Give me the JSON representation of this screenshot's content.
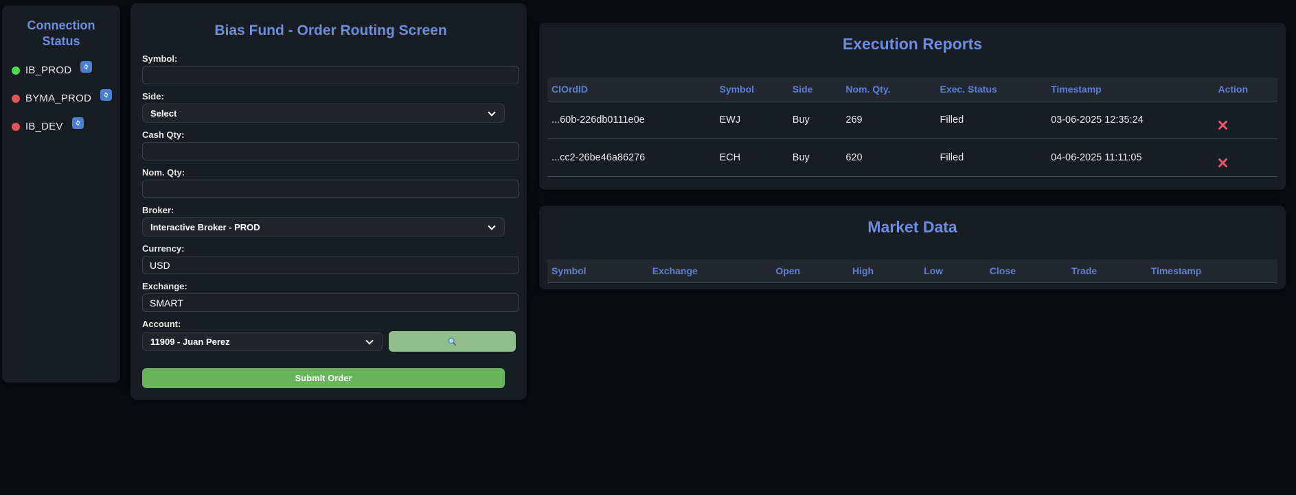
{
  "sidebar": {
    "title": "Connection Status",
    "connections": [
      {
        "name": "IB_PROD",
        "status": "connected",
        "status_color": "#4cd94c"
      },
      {
        "name": "BYMA_PROD",
        "status": "disconnected",
        "status_color": "#e05555"
      },
      {
        "name": "IB_DEV",
        "status": "disconnected",
        "status_color": "#e05555"
      }
    ]
  },
  "order_form": {
    "title": "Bias Fund - Order Routing Screen",
    "fields": {
      "symbol": {
        "label": "Symbol:",
        "value": ""
      },
      "side": {
        "label": "Side:",
        "value": "Select"
      },
      "cash_qty": {
        "label": "Cash Qty:",
        "value": ""
      },
      "nom_qty": {
        "label": "Nom. Qty:",
        "value": ""
      },
      "broker": {
        "label": "Broker:",
        "value": "Interactive Broker - PROD"
      },
      "currency": {
        "label": "Currency:",
        "value": "USD"
      },
      "exchange": {
        "label": "Exchange:",
        "value": "SMART"
      },
      "account": {
        "label": "Account:",
        "value": "11909 - Juan Perez"
      }
    },
    "submit_label": "Submit Order"
  },
  "execution_reports": {
    "title": "Execution Reports",
    "columns": [
      "ClOrdID",
      "Symbol",
      "Side",
      "Nom. Qty.",
      "Exec. Status",
      "Timestamp",
      "Action"
    ],
    "rows": [
      {
        "clordid": "...60b-226db0111e0e",
        "symbol": "EWJ",
        "side": "Buy",
        "nom_qty": "269",
        "exec_status": "Filled",
        "timestamp": "03-06-2025 12:35:24"
      },
      {
        "clordid": "...cc2-26be46a86276",
        "symbol": "ECH",
        "side": "Buy",
        "nom_qty": "620",
        "exec_status": "Filled",
        "timestamp": "04-06-2025 11:11:05"
      }
    ]
  },
  "market_data": {
    "title": "Market Data",
    "columns": [
      "Symbol",
      "Exchange",
      "Open",
      "High",
      "Low",
      "Close",
      "Trade",
      "Timestamp"
    ],
    "rows": []
  },
  "colors": {
    "accent_blue_title": "#6d8ede",
    "table_header_blue": "#5d80d6",
    "submit_green": "#68b35c",
    "search_green": "#8fbe8c",
    "refresh_blue": "#4d7fd0",
    "action_red": "#e4566e",
    "status_green": "#4cd94c",
    "status_red": "#e05555",
    "panel_bg": "#181c23",
    "page_bg": "#0a0c10"
  }
}
